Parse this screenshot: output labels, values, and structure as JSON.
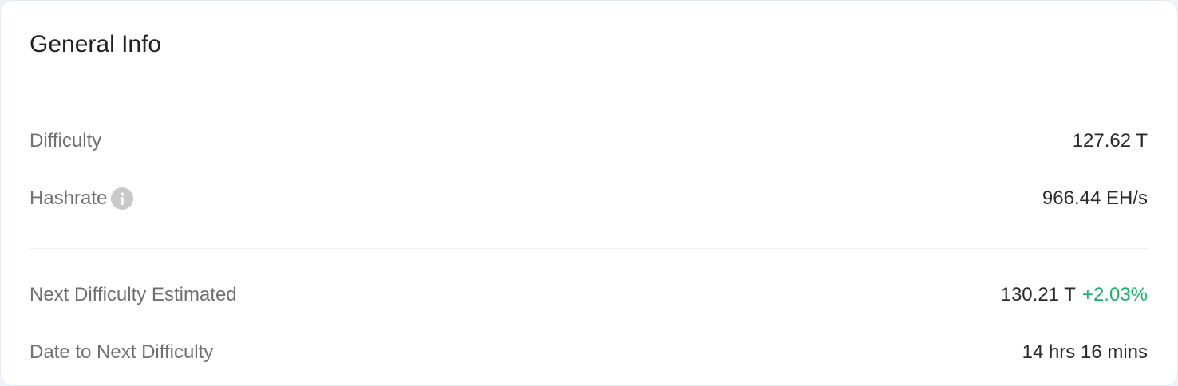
{
  "card": {
    "title": "General Info"
  },
  "rows": [
    {
      "label": "Difficulty",
      "value": "127.62 T"
    },
    {
      "label": "Hashrate",
      "value": "966.44 EH/s",
      "icon": "info-icon"
    },
    {
      "label": "Next Difficulty Estimated",
      "value": "130.21 T",
      "change": "+2.03%"
    },
    {
      "label": "Date to Next Difficulty",
      "value": "14 hrs 16 mins"
    }
  ],
  "colors": {
    "positive_change": "#1db56a",
    "label_text": "#707070",
    "value_text": "#2b2b2b",
    "info_icon_bg": "#c9c9c9"
  }
}
